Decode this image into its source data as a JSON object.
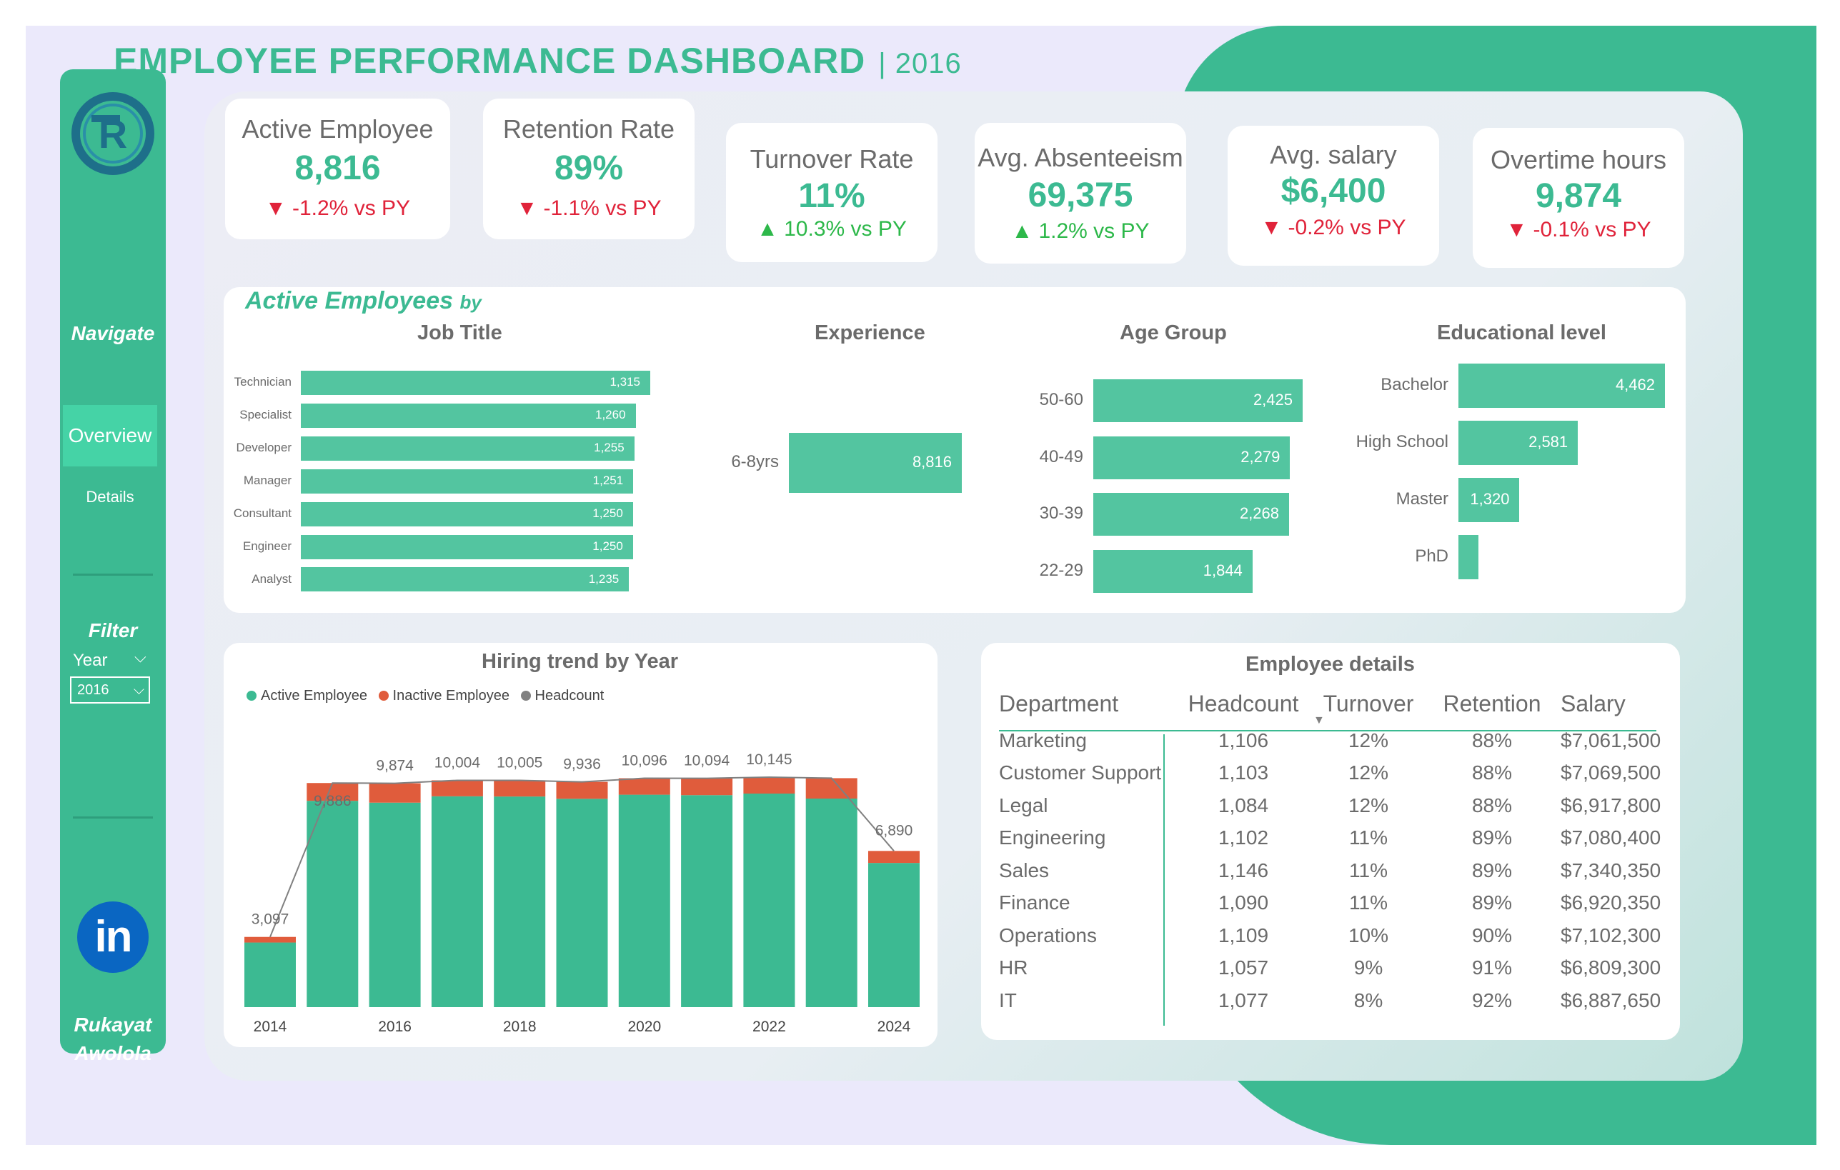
{
  "header": {
    "title": "EMPLOYEE PERFORMANCE DASHBOARD",
    "year": "| 2016"
  },
  "colors": {
    "accent": "#3cba92",
    "bar": "#53c5a0",
    "inactive": "#e05c3c",
    "headcount": "#808080",
    "down": "#e0233a",
    "up": "#2db84a"
  },
  "sidebar": {
    "logo_icon": "tr-logo-icon",
    "navigate_label": "Navigate",
    "nav_items": [
      {
        "label": "Overview",
        "active": true
      },
      {
        "label": "Details",
        "active": false
      }
    ],
    "filter_label": "Filter",
    "year_label": "Year",
    "year_value": "2016",
    "linkedin_icon": "linkedin-icon",
    "linkedin_text": "in",
    "author_line1": "Rukayat",
    "author_line2": "Awolola"
  },
  "kpis": [
    {
      "label": "Active Employee",
      "value": "8,816",
      "change": "-1.2% vs PY",
      "direction": "down"
    },
    {
      "label": "Retention Rate",
      "value": "89%",
      "change": "-1.1% vs PY",
      "direction": "down"
    },
    {
      "label": "Turnover Rate",
      "value": "11%",
      "change": "10.3% vs PY",
      "direction": "up"
    },
    {
      "label": "Avg. Absenteeism",
      "value": "69,375",
      "change": "1.2% vs PY",
      "direction": "up"
    },
    {
      "label": "Avg. salary",
      "value": "$6,400",
      "change": "-0.2% vs PY",
      "direction": "down"
    },
    {
      "label": "Overtime hours",
      "value": "9,874",
      "change": "-0.1% vs PY",
      "direction": "down"
    }
  ],
  "active_section": {
    "title": "Active Employees",
    "by": "by"
  },
  "chart_data": [
    {
      "type": "bar",
      "title": "Job Title",
      "orientation": "horizontal",
      "categories": [
        "Technician",
        "Specialist",
        "Developer",
        "Manager",
        "Consultant",
        "Engineer",
        "Analyst"
      ],
      "values": [
        1315,
        1260,
        1255,
        1251,
        1250,
        1250,
        1235
      ],
      "labels": [
        "1,315",
        "1,260",
        "1,255",
        "1,251",
        "1,250",
        "1,250",
        "1,235"
      ]
    },
    {
      "type": "bar",
      "title": "Experience",
      "orientation": "horizontal",
      "categories": [
        "6-8yrs"
      ],
      "values": [
        8816
      ],
      "labels": [
        "8,816"
      ]
    },
    {
      "type": "bar",
      "title": "Age Group",
      "orientation": "horizontal",
      "categories": [
        "50-60",
        "40-49",
        "30-39",
        "22-29"
      ],
      "values": [
        2425,
        2279,
        2268,
        1844
      ],
      "labels": [
        "2,425",
        "2,279",
        "2,268",
        "1,844"
      ]
    },
    {
      "type": "bar",
      "title": "Educational level",
      "orientation": "horizontal",
      "categories": [
        "Bachelor",
        "High School",
        "Master",
        "PhD"
      ],
      "values": [
        4462,
        2581,
        1320,
        430
      ],
      "labels": [
        "4,462",
        "2,581",
        "1,320",
        ""
      ]
    },
    {
      "type": "bar",
      "title": "Hiring trend by Year",
      "stacked": true,
      "x": [
        2014,
        2015,
        2016,
        2017,
        2018,
        2019,
        2020,
        2021,
        2022,
        2023,
        2024
      ],
      "x_tick_labels": [
        "2014",
        "2016",
        "2018",
        "2020",
        "2022",
        "2024"
      ],
      "x_ticks": [
        2014,
        2016,
        2018,
        2020,
        2022,
        2024
      ],
      "series": [
        {
          "name": "Active Employee",
          "values": [
            2850,
            9100,
            9020,
            9300,
            9290,
            9190,
            9370,
            9350,
            9420,
            9200,
            6360
          ]
        },
        {
          "name": "Inactive Employee",
          "values": [
            247,
            786,
            854,
            704,
            715,
            746,
            726,
            744,
            725,
            900,
            530
          ]
        },
        {
          "name": "Headcount",
          "values": [
            3097,
            9886,
            9874,
            10004,
            10005,
            9936,
            10096,
            10094,
            10145,
            10100,
            6890
          ]
        }
      ],
      "data_labels": [
        "3,097",
        "9,886",
        "9,874",
        "10,004",
        "10,005",
        "9,936",
        "10,096",
        "10,094",
        "10,145",
        "",
        "6,890"
      ],
      "ylim": [
        0,
        11500
      ]
    }
  ],
  "details": {
    "title": "Employee details",
    "columns": [
      "Department",
      "Headcount",
      "Turnover",
      "Retention",
      "Salary"
    ],
    "sort_icon": "sort-down-icon",
    "rows": [
      [
        "Marketing",
        "1,106",
        "12%",
        "88%",
        "$7,061,500"
      ],
      [
        "Customer Support",
        "1,103",
        "12%",
        "88%",
        "$7,069,500"
      ],
      [
        "Legal",
        "1,084",
        "12%",
        "88%",
        "$6,917,800"
      ],
      [
        "Engineering",
        "1,102",
        "11%",
        "89%",
        "$7,080,400"
      ],
      [
        "Sales",
        "1,146",
        "11%",
        "89%",
        "$7,340,350"
      ],
      [
        "Finance",
        "1,090",
        "11%",
        "89%",
        "$6,920,350"
      ],
      [
        "Operations",
        "1,109",
        "10%",
        "90%",
        "$7,102,300"
      ],
      [
        "HR",
        "1,057",
        "9%",
        "91%",
        "$6,809,300"
      ],
      [
        "IT",
        "1,077",
        "8%",
        "92%",
        "$6,887,650"
      ]
    ]
  }
}
